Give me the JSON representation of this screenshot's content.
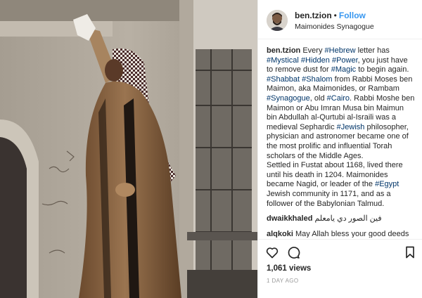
{
  "post": {
    "username": "ben.tzion",
    "separator": "•",
    "follow_label": "Follow",
    "location": "Maimonides Synagogue"
  },
  "caption": {
    "author": "ben.tzion",
    "parts": [
      "Every ",
      "#Hebrew",
      " letter has ",
      "#Mystical",
      " ",
      "#Hidden",
      " ",
      "#Power",
      ", you just have to remove dust for ",
      "#Magic",
      " to begin again. ",
      "#Shabbat",
      " ",
      "#Shalom",
      " from Rabbi Moses ben Maimon, aka Maimonides, or Rambam ",
      "#Synagogue",
      ", old ",
      "#Cairo",
      ". Rabbi Moshe ben Maimon or Abu Imran Musa bin Maimun bin Abdullah al-Qurtubi al-Israili was a medieval Sephardic ",
      "#Jewish",
      " philosopher, physician and astronomer became one of the most prolific and influential Torah scholars of the Middle Ages.",
      "Settled in Fustat about 1168, lived there until his death in 1204. Maimonides became Nagid, or leader of the ",
      "#Egypt",
      " Jewish community in 1171, and as a follower of the Babylonian Talmud."
    ]
  },
  "comments": [
    {
      "user": "dwaikkhaled",
      "text": "فين الصور دي يامعلم"
    },
    {
      "user": "alqkoki",
      "text": "May Allah bless your good deeds"
    }
  ],
  "stats": {
    "views": "1,061 views",
    "time": "1 DAY AGO"
  },
  "icons": {
    "like": "heart-icon",
    "comment": "comment-icon",
    "save": "bookmark-icon"
  },
  "colors": {
    "link": "#3897f0",
    "hashtag": "#003569",
    "muted": "#999999"
  }
}
